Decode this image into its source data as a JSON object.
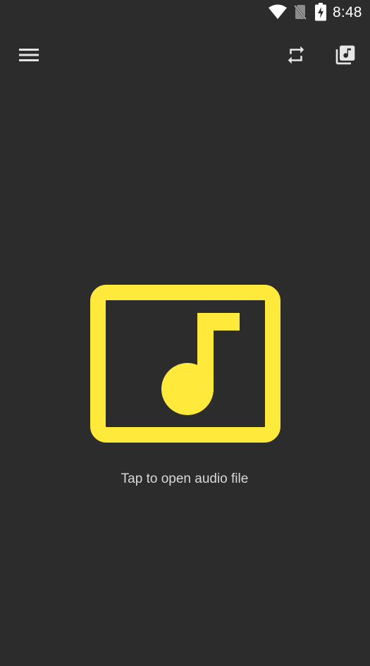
{
  "status_bar": {
    "time": "8:48",
    "icons": [
      "wifi-icon",
      "no-sim-icon",
      "battery-charging-icon"
    ]
  },
  "toolbar": {
    "menu_icon": "hamburger-menu-icon",
    "repeat_icon": "repeat-icon",
    "playlist_icon": "music-library-icon"
  },
  "main": {
    "icon": "audio-file-icon",
    "hint": "Tap to open audio file"
  },
  "colors": {
    "background": "#2c2c2c",
    "accent": "#ffe93b",
    "icon": "#e6e6e6",
    "text": "#d8d8d8"
  }
}
